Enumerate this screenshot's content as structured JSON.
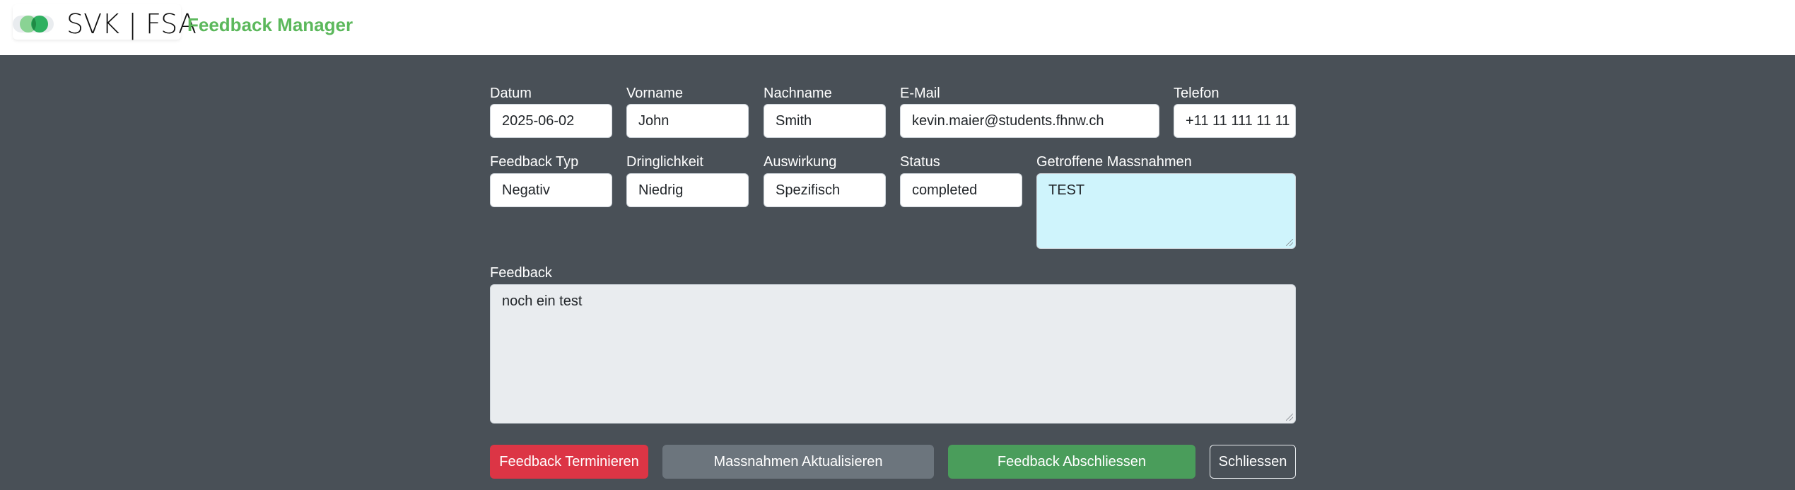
{
  "brand": {
    "name": "SVK | FSA",
    "app_title": "Feedback Manager"
  },
  "form": {
    "datum": {
      "label": "Datum",
      "value": "2025-06-02"
    },
    "vorname": {
      "label": "Vorname",
      "value": "John"
    },
    "nachname": {
      "label": "Nachname",
      "value": "Smith"
    },
    "email": {
      "label": "E-Mail",
      "value": "kevin.maier@students.fhnw.ch"
    },
    "telefon": {
      "label": "Telefon",
      "value": "+11 11 111 11 11"
    },
    "feedback_typ": {
      "label": "Feedback Typ",
      "value": "Negativ"
    },
    "dringlichkeit": {
      "label": "Dringlichkeit",
      "value": "Niedrig"
    },
    "auswirkung": {
      "label": "Auswirkung",
      "value": "Spezifisch"
    },
    "status": {
      "label": "Status",
      "value": "completed"
    },
    "massnahmen": {
      "label": "Getroffene Massnahmen",
      "value": "TEST"
    },
    "feedback": {
      "label": "Feedback",
      "value": "noch ein test"
    }
  },
  "actions": {
    "terminate": "Feedback Terminieren",
    "update": "Massnahmen Aktualisieren",
    "complete": "Feedback Abschliessen",
    "close": "Schliessen"
  },
  "colors": {
    "background": "#495057",
    "brand_green": "#5cb85c",
    "danger": "#dc3545",
    "secondary": "#6c757d",
    "success": "#4a9d5b",
    "massnahmen_bg": "#cff4fc",
    "feedback_bg": "#e9ecef"
  }
}
